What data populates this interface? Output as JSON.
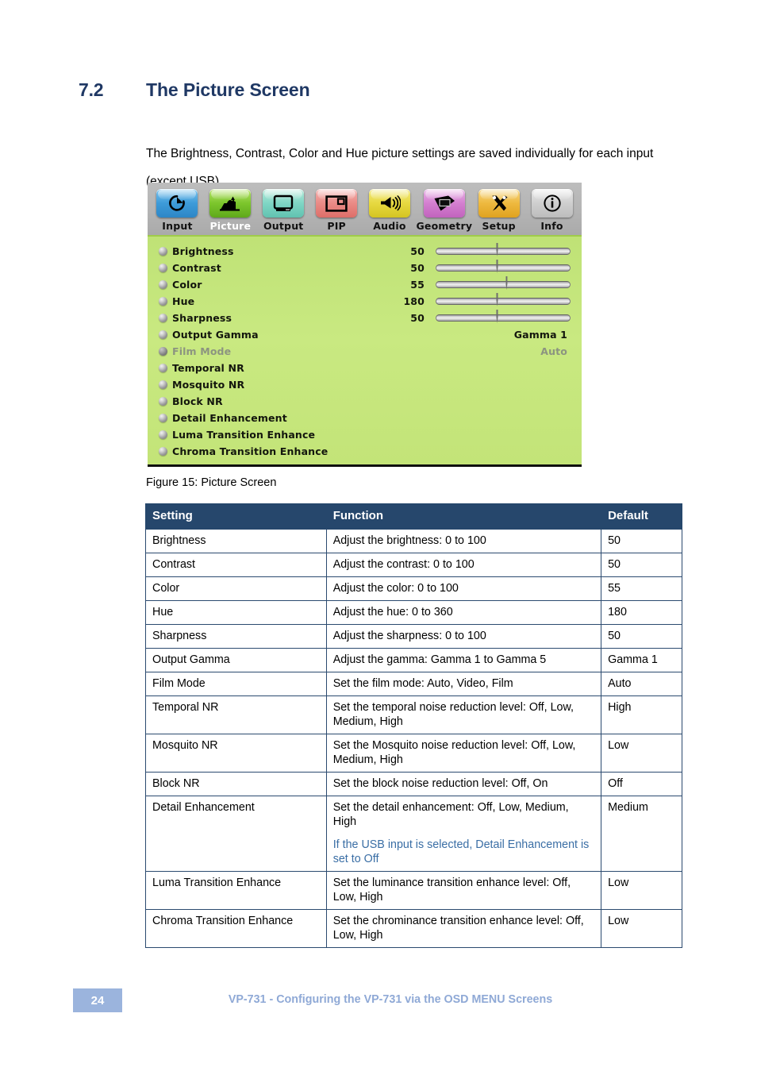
{
  "section": {
    "number": "7.2",
    "title": "The Picture Screen",
    "intro": "The Brightness, Contrast, Color and Hue picture settings are saved individually for each input (except USB)."
  },
  "osd": {
    "toolbar": [
      {
        "label": "Input",
        "icon": "input-icon",
        "selected": false
      },
      {
        "label": "Picture",
        "icon": "picture-icon",
        "selected": true
      },
      {
        "label": "Output",
        "icon": "output-icon",
        "selected": false
      },
      {
        "label": "PIP",
        "icon": "pip-icon",
        "selected": false
      },
      {
        "label": "Audio",
        "icon": "audio-icon",
        "selected": false
      },
      {
        "label": "Geometry",
        "icon": "geometry-icon",
        "selected": false
      },
      {
        "label": "Setup",
        "icon": "setup-icon",
        "selected": false
      },
      {
        "label": "Info",
        "icon": "info-icon",
        "selected": false
      }
    ],
    "rows": [
      {
        "name": "Brightness",
        "value": "50",
        "slider": 50,
        "disabled": false,
        "type": "slider"
      },
      {
        "name": "Contrast",
        "value": "50",
        "slider": 50,
        "disabled": false,
        "type": "slider"
      },
      {
        "name": "Color",
        "value": "55",
        "slider": 57,
        "disabled": false,
        "type": "slider"
      },
      {
        "name": "Hue",
        "value": "180",
        "slider": 50,
        "disabled": false,
        "type": "slider"
      },
      {
        "name": "Sharpness",
        "value": "50",
        "slider": 50,
        "disabled": false,
        "type": "slider"
      },
      {
        "name": "Output Gamma",
        "value": "Gamma 1",
        "disabled": false,
        "type": "text"
      },
      {
        "name": "Film Mode",
        "value": "Auto",
        "disabled": true,
        "type": "text"
      },
      {
        "name": "Temporal NR",
        "value": "",
        "disabled": false,
        "type": "none"
      },
      {
        "name": "Mosquito NR",
        "value": "",
        "disabled": false,
        "type": "none"
      },
      {
        "name": "Block NR",
        "value": "",
        "disabled": false,
        "type": "none"
      },
      {
        "name": "Detail Enhancement",
        "value": "",
        "disabled": false,
        "type": "none"
      },
      {
        "name": "Luma Transition Enhance",
        "value": "",
        "disabled": false,
        "type": "none"
      },
      {
        "name": "Chroma Transition Enhance",
        "value": "",
        "disabled": false,
        "type": "none"
      }
    ]
  },
  "figure": {
    "caption": "Figure 15: Picture Screen"
  },
  "table": {
    "headers": [
      "Setting",
      "Function",
      "Default"
    ],
    "rows": [
      {
        "setting": "Brightness",
        "function": "Adjust the brightness: 0 to 100",
        "note": "",
        "default": "50"
      },
      {
        "setting": "Contrast",
        "function": "Adjust the contrast: 0 to 100",
        "note": "",
        "default": "50"
      },
      {
        "setting": "Color",
        "function": "Adjust the color: 0 to 100",
        "note": "",
        "default": "55"
      },
      {
        "setting": "Hue",
        "function": "Adjust the hue: 0 to 360",
        "note": "",
        "default": "180"
      },
      {
        "setting": "Sharpness",
        "function": "Adjust the sharpness: 0 to 100",
        "note": "",
        "default": "50"
      },
      {
        "setting": "Output Gamma",
        "function": "Adjust the gamma: Gamma 1 to Gamma 5",
        "note": "",
        "default": "Gamma 1"
      },
      {
        "setting": "Film Mode",
        "function": "Set the film mode: Auto, Video, Film",
        "note": "",
        "default": "Auto"
      },
      {
        "setting": "Temporal NR",
        "function": "Set the temporal noise reduction level: Off, Low, Medium, High",
        "note": "",
        "default": "High"
      },
      {
        "setting": "Mosquito NR",
        "function": "Set the Mosquito noise reduction level: Off, Low, Medium, High",
        "note": "",
        "default": "Low"
      },
      {
        "setting": "Block NR",
        "function": "Set the block noise reduction level: Off, On",
        "note": "",
        "default": "Off"
      },
      {
        "setting": "Detail Enhancement",
        "function": "Set the detail enhancement: Off, Low, Medium, High",
        "note": "If the USB input is selected, Detail Enhancement is set to Off",
        "default": "Medium"
      },
      {
        "setting": "Luma Transition Enhance",
        "function": "Set the luminance transition enhance level: Off, Low, High",
        "note": "",
        "default": "Low"
      },
      {
        "setting": "Chroma Transition Enhance",
        "function": "Set the chrominance transition enhance level: Off, Low, High",
        "note": "",
        "default": "Low"
      }
    ]
  },
  "footer": {
    "page_number": "24",
    "text": "VP-731 - Configuring the VP-731 via the OSD MENU Screens"
  }
}
